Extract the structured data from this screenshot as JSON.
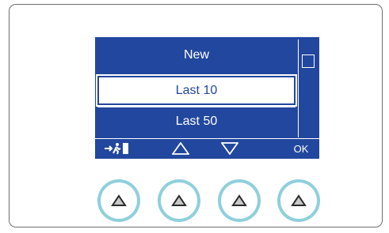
{
  "display": {
    "background_color": "#22479e",
    "menu": {
      "items": [
        {
          "label": "New",
          "selected": false
        },
        {
          "label": "Last 10",
          "selected": true
        },
        {
          "label": "Last 50",
          "selected": false
        }
      ]
    },
    "scrollbar": {
      "position_fraction": 0.0
    },
    "softkeys": {
      "exit_icon": "exit-running-man-icon",
      "up_icon": "triangle-up-outline-icon",
      "down_icon": "triangle-down-outline-icon",
      "ok_label": "OK"
    }
  },
  "hardware_buttons": [
    {
      "icon": "triangle-up-icon"
    },
    {
      "icon": "triangle-up-icon"
    },
    {
      "icon": "triangle-up-icon"
    },
    {
      "icon": "triangle-up-icon"
    }
  ],
  "colors": {
    "button_ring": "#8fd0dc",
    "panel_border": "#6e6e6e",
    "text_on_display": "#ffffff"
  }
}
